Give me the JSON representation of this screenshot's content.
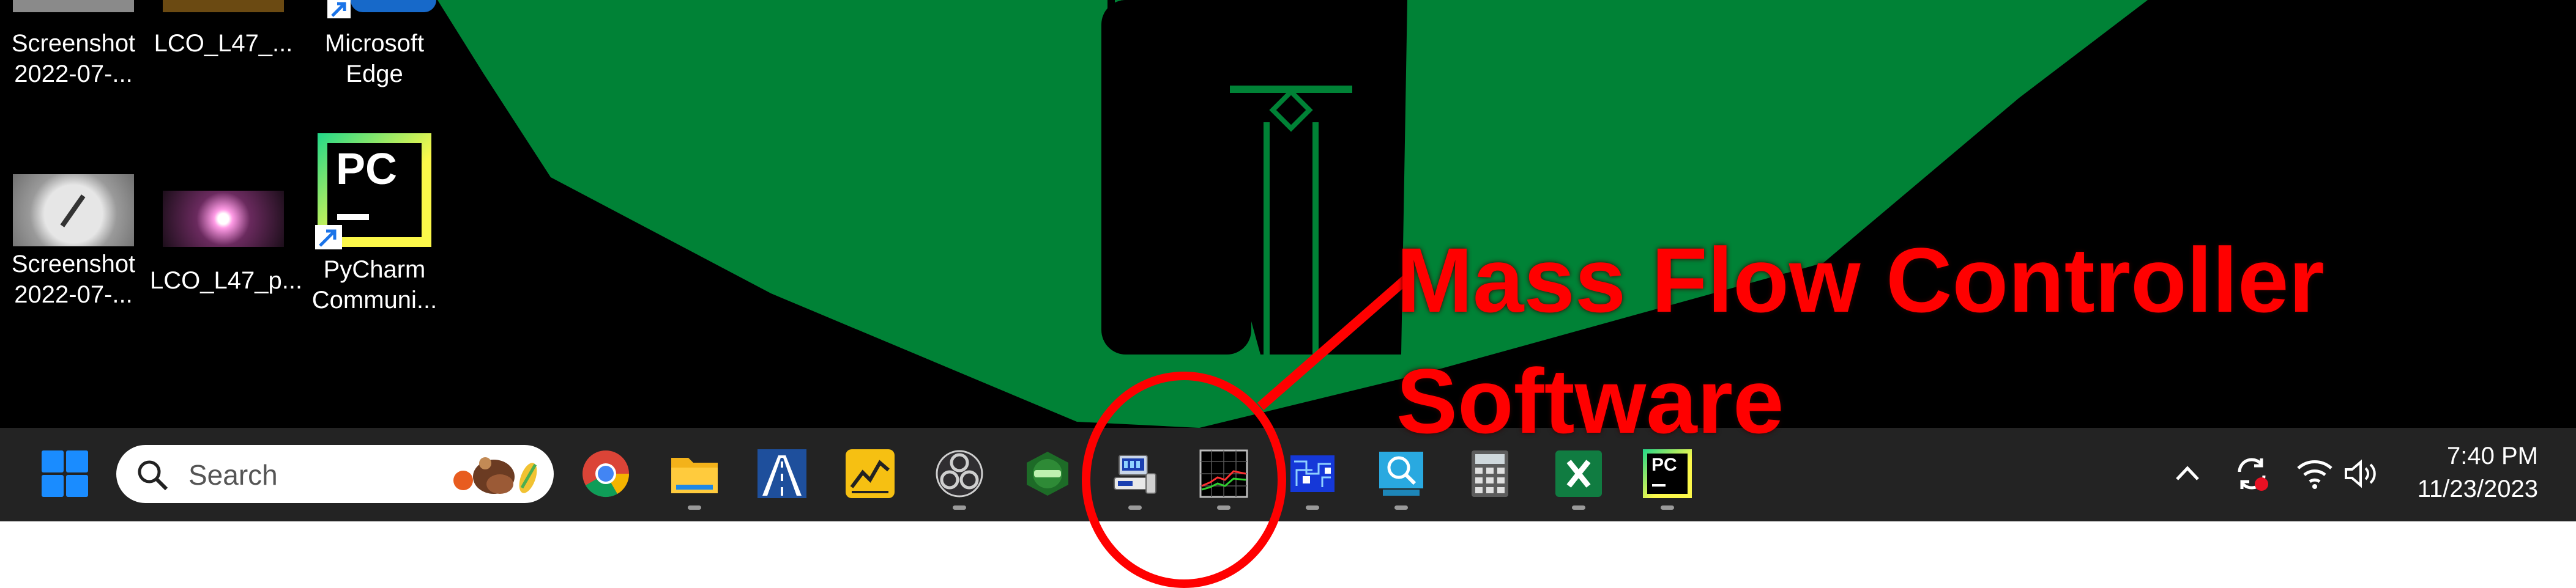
{
  "desktop": {
    "icons": [
      {
        "label_line1": "Screenshot",
        "label_line2": "2022-07-..."
      },
      {
        "label_line1": "LCO_L47_...",
        "label_line2": ""
      },
      {
        "label_line1": "Microsoft",
        "label_line2": "Edge"
      },
      {
        "label_line1": "Screenshot",
        "label_line2": "2022-07-..."
      },
      {
        "label_line1": "LCO_L47_p...",
        "label_line2": ""
      },
      {
        "label_line1": "PyCharm",
        "label_line2": "Communi..."
      }
    ],
    "pycharm_icon_text": "PC"
  },
  "taskbar": {
    "search_placeholder": "Search",
    "apps": [
      {
        "icon": "chrome-icon"
      },
      {
        "icon": "file-explorer-icon"
      },
      {
        "icon": "road-app-icon"
      },
      {
        "icon": "stock-chart-app-icon"
      },
      {
        "icon": "obs-studio-icon"
      },
      {
        "icon": "green-badge-app-icon"
      },
      {
        "icon": "mass-flow-device-icon"
      },
      {
        "icon": "flow-chart-monitor-icon"
      },
      {
        "icon": "circuit-app-icon"
      },
      {
        "icon": "magnifier-app-icon"
      },
      {
        "icon": "calculator-icon"
      },
      {
        "icon": "excel-icon"
      },
      {
        "icon": "pycharm-icon"
      }
    ],
    "pycharm_icon_text": "PC",
    "tray": {
      "time": "7:40 PM",
      "date": "11/23/2023"
    }
  },
  "annotation": {
    "line1": "Mass Flow Controller",
    "line2": "Software",
    "color": "#ff0000"
  },
  "colors": {
    "wallpaper_green": "#008236",
    "taskbar_bg": "#232323",
    "windows_blue": "#1a8cff"
  }
}
